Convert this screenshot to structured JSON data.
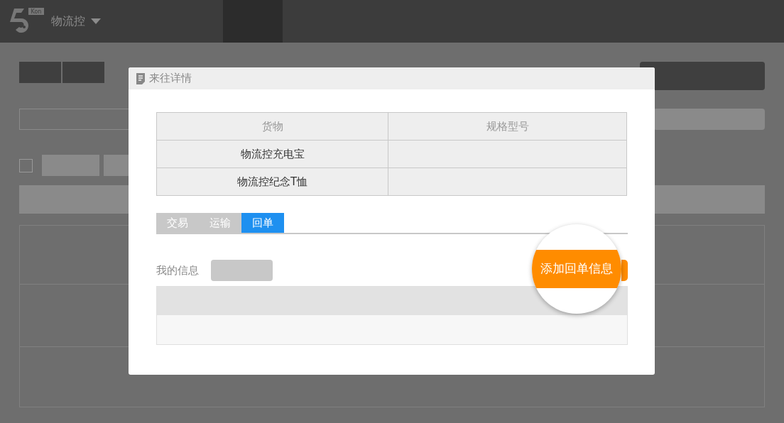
{
  "header": {
    "logo_badge": "Kon",
    "brand": "物流控"
  },
  "filters": {
    "select_all": {
      "checked": false
    }
  },
  "dialog": {
    "title": "来往详情",
    "goods_table": {
      "columns": [
        "货物",
        "规格型号"
      ],
      "rows": [
        {
          "goods": "物流控充电宝"
        },
        {
          "goods": "物流控纪念T恤"
        }
      ]
    },
    "tabs": [
      {
        "label": "交易",
        "selected": false
      },
      {
        "label": "运输",
        "selected": false
      },
      {
        "label": "回单",
        "selected": true
      }
    ],
    "my_info_label": "我的信息",
    "add_button": {
      "label": "添加回单信息"
    }
  }
}
